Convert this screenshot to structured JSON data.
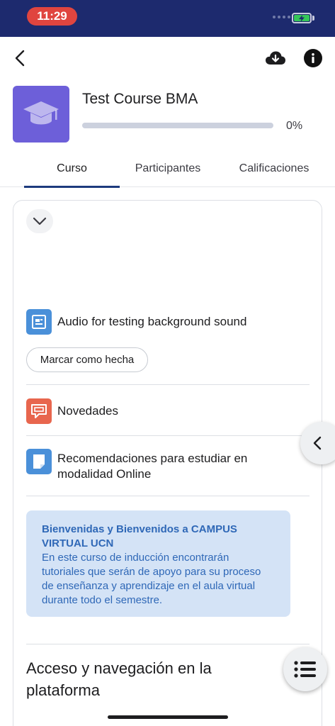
{
  "status_bar": {
    "time": "11:29"
  },
  "course": {
    "title": "Test Course BMA",
    "progress_percent": 0,
    "progress_label": "0%"
  },
  "tabs": [
    {
      "label": "Curso",
      "active": true
    },
    {
      "label": "Participantes",
      "active": false
    },
    {
      "label": "Calificaciones",
      "active": false
    }
  ],
  "activities": [
    {
      "label": "Audio for testing background sound",
      "icon": "page-icon",
      "button": "Marcar como hecha"
    },
    {
      "label": "Novedades",
      "icon": "forum-icon"
    },
    {
      "label": "Recomendaciones para estudiar en modalidad Online",
      "icon": "document-icon"
    }
  ],
  "welcome": {
    "title": "Bienvenidas y Bienvenidos a CAMPUS VIRTUAL UCN",
    "body": "En este curso de inducción encontrarán tutoriales que serán de apoyo para su proceso de enseñanza y aprendizaje en el aula virtual durante todo el semestre."
  },
  "section": {
    "title": "Acceso y navegación en la plataforma"
  },
  "colors": {
    "status_bar": "#1d2a6e",
    "accent": "#1d3a7d",
    "course_image": "#6d5fd9",
    "welcome_bg": "#d4e3f6",
    "welcome_text": "#2f68b7"
  }
}
